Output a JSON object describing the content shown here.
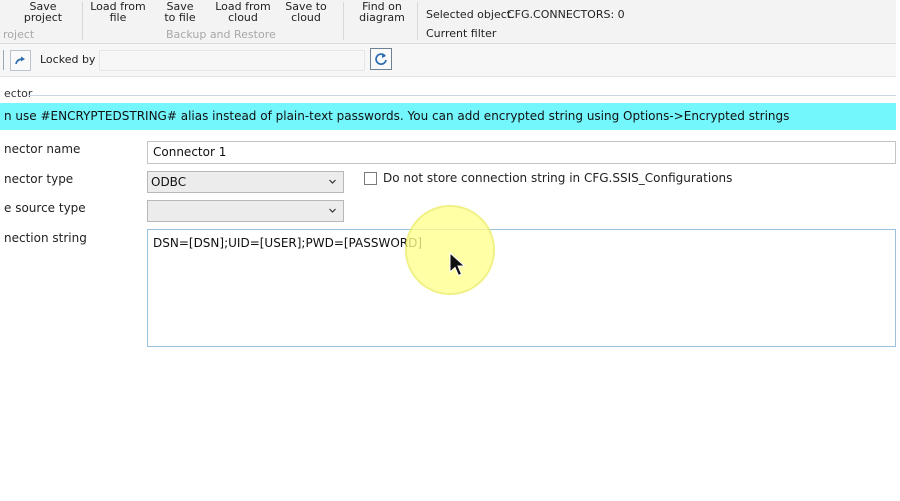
{
  "ribbon": {
    "buttons": [
      {
        "name": "save-project-button",
        "label": "Save\nproject"
      },
      {
        "name": "load-from-file-button",
        "label": "Load from\nfile"
      },
      {
        "name": "save-to-file-button",
        "label": "Save\nto file"
      },
      {
        "name": "load-from-cloud-button",
        "label": "Load from\ncloud"
      },
      {
        "name": "save-to-cloud-button",
        "label": "Save to\ncloud"
      },
      {
        "name": "find-on-diagram-button",
        "label": "Find on\ndiagram"
      }
    ],
    "groups": {
      "project": "roject",
      "backup": "Backup and Restore"
    },
    "selected_object_label": "Selected object",
    "selected_object_value": "CFG.CONNECTORS: 0",
    "current_filter_label": "Current filter"
  },
  "toolbar": {
    "locked_by_label": "Locked by",
    "locked_by_value": ""
  },
  "section": {
    "title": "ector"
  },
  "banner": {
    "text": "n use #ENCRYPTEDSTRING# alias instead of plain-text passwords. You can add encrypted string using Options->Encrypted strings"
  },
  "form": {
    "connector_name_label": "nector name",
    "connector_name_value": "Connector 1",
    "connector_type_label": "nector type",
    "connector_type_value": "ODBC",
    "do_not_store_label": "Do not store connection string in CFG.SSIS_Configurations",
    "do_not_store_checked": false,
    "data_source_type_label": "e source type",
    "data_source_type_value": "",
    "connection_string_label": "nection string",
    "connection_string_value": "DSN=[DSN];UID=[USER];PWD=[PASSWORD]"
  },
  "colors": {
    "banner": "#73f7fd",
    "highlight": "#ffff8c",
    "accent": "#2f6fb0"
  },
  "icons": [
    "redo-icon",
    "refresh-icon",
    "chevron-down-icon",
    "mouse-pointer-icon"
  ]
}
